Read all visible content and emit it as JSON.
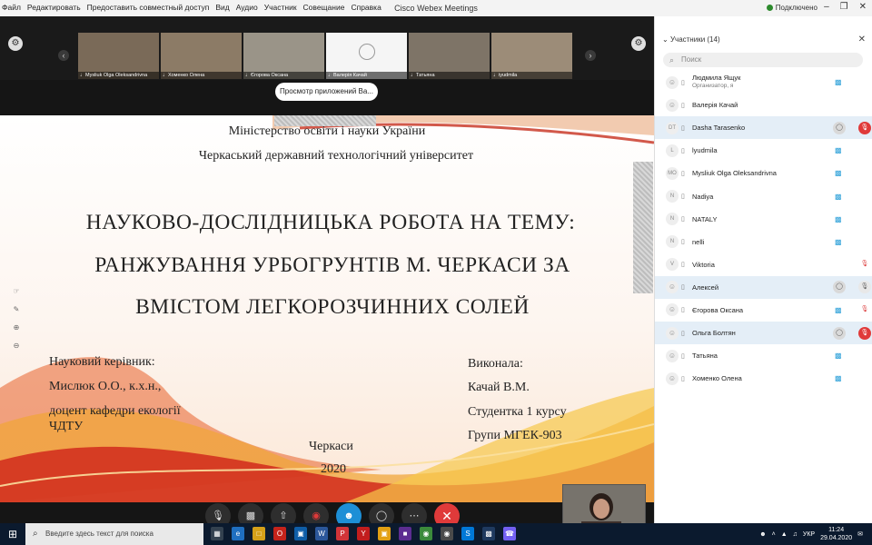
{
  "window": {
    "title": "Cisco Webex Meetings",
    "menu": [
      "Файл",
      "Редактировать",
      "Предоставить совместный доступ",
      "Вид",
      "Аудио",
      "Участник",
      "Совещание",
      "Справка"
    ],
    "connection_status": "Подключено"
  },
  "thumbnails": [
    {
      "name": "Mysliuk Olga Oleksandrivna",
      "bg": "#7a6a58"
    },
    {
      "name": "Хоменко Олена",
      "bg": "#8c7b66"
    },
    {
      "name": "Єгорова Оксана",
      "bg": "#9a9488"
    },
    {
      "name": "Валерія Качай",
      "bg": "#f5f5f5"
    },
    {
      "name": "Татьяна",
      "bg": "#7e7467"
    },
    {
      "name": "iyudmila",
      "bg": "#9c8c78"
    }
  ],
  "app_view_button": "Просмотр приложений Ва...",
  "slide": {
    "ministry": "Міністерство освіти і науки України",
    "university": "Черкаський державний технологічний університет",
    "title_lines": [
      "НАУКОВО-ДОСЛІДНИЦЬКА РОБОТА НА ТЕМУ:",
      "РАНЖУВАННЯ  УРБОГРУНТІВ М. ЧЕРКАСИ ЗА",
      "ВМІСТОМ ЛЕГКОРОЗЧИННИХ СОЛЕЙ"
    ],
    "supervisor_lines": [
      "Науковий керівник:",
      "Мислюк О.О., к.х.н.,",
      "доцент кафедри екології",
      "ЧДТУ"
    ],
    "performer_lines": [
      "Виконала:",
      "Качай В.М.",
      "Студентка 1 курсу",
      "Групи МГЕК-903"
    ],
    "city": "Черкаси",
    "year": "2020"
  },
  "participants_panel": {
    "header": "Участники (14)",
    "search_placeholder": "Поиск",
    "participants": [
      {
        "avatar": "",
        "name": "Людмила Ящук",
        "sub": "Организатор, я",
        "video": true,
        "mic": "none",
        "highlight": false
      },
      {
        "avatar": "",
        "name": "Валерія Качай",
        "sub": "",
        "video": false,
        "mic": "none",
        "highlight": false
      },
      {
        "avatar": "DT",
        "name": "Dasha Tarasenko",
        "sub": "",
        "video": false,
        "mic": "red",
        "chat": true,
        "highlight": true
      },
      {
        "avatar": "L",
        "name": "lyudmila",
        "sub": "",
        "video": true,
        "mic": "none",
        "highlight": false
      },
      {
        "avatar": "MO",
        "name": "Mysliuk Olga Oleksandrivna",
        "sub": "",
        "video": true,
        "mic": "none",
        "highlight": false
      },
      {
        "avatar": "N",
        "name": "Nadiya",
        "sub": "",
        "video": true,
        "mic": "none",
        "highlight": false
      },
      {
        "avatar": "N",
        "name": "NATALY",
        "sub": "",
        "video": true,
        "mic": "none",
        "highlight": false
      },
      {
        "avatar": "N",
        "name": "nelli",
        "sub": "",
        "video": true,
        "mic": "none",
        "highlight": false
      },
      {
        "avatar": "V",
        "name": "Viktoria",
        "sub": "",
        "video": false,
        "mic": "plain",
        "highlight": false
      },
      {
        "avatar": "",
        "name": "Алексей",
        "sub": "",
        "video": false,
        "mic": "grey",
        "chat": true,
        "highlight": true
      },
      {
        "avatar": "",
        "name": "Єгорова Оксана",
        "sub": "",
        "video": true,
        "mic": "plain",
        "highlight": false
      },
      {
        "avatar": "",
        "name": "Ольга  Болтян",
        "sub": "",
        "video": false,
        "mic": "red",
        "chat": true,
        "highlight": true
      },
      {
        "avatar": "",
        "name": "Татьяна",
        "sub": "",
        "video": true,
        "mic": "none",
        "highlight": false
      },
      {
        "avatar": "",
        "name": "Хоменко Олена",
        "sub": "",
        "video": true,
        "mic": "none",
        "highlight": false
      }
    ]
  },
  "taskbar": {
    "search_placeholder": "Введите здесь текст для поиска",
    "language": "УКР",
    "time": "11:24",
    "date": "29.04.2020"
  },
  "colors": {
    "accent": "#1d8fd6",
    "end_call": "#e03a3a",
    "video_icon": "#2a9fd8"
  }
}
